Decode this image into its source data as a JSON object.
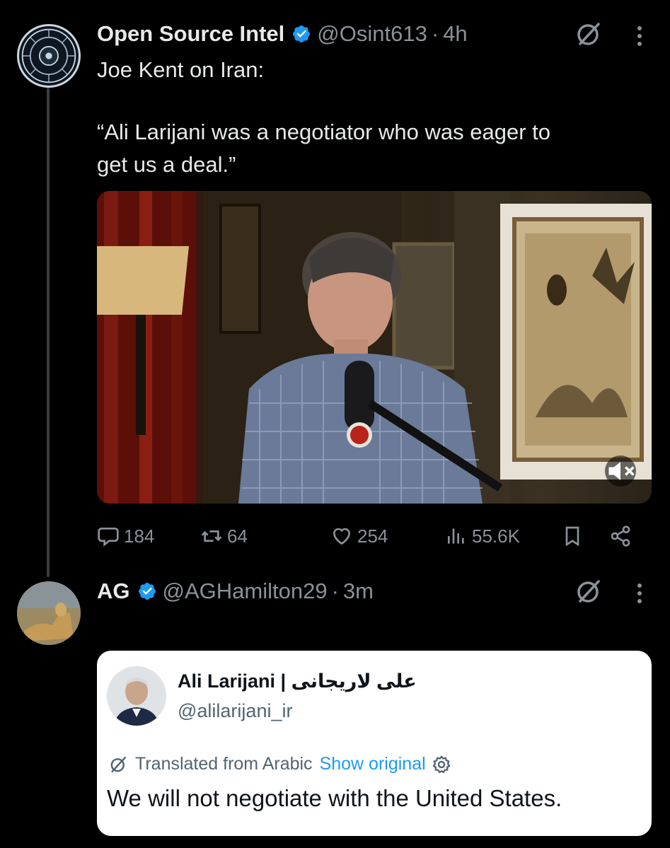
{
  "colors": {
    "background": "#000000",
    "text_primary": "#e7e9ea",
    "text_secondary": "#8b9198",
    "verified": "#1d9bf0",
    "link": "#1d9bf0"
  },
  "tweet": {
    "author_name": "Open Source Intel",
    "handle": "@Osint613",
    "separator": "·",
    "time": "4h",
    "text_line1": "Joe Kent on Iran:",
    "text_line2": "“Ali Larijani was a negotiator who was eager to",
    "text_line3": "get us a deal.”",
    "media": {
      "type": "video",
      "watermark_icon": "tucker-carlson-logo",
      "mute_icon": "speaker-muted-icon"
    },
    "actions": {
      "replies": "184",
      "reposts": "64",
      "likes": "254",
      "views": "55.6K"
    }
  },
  "reply": {
    "author_name": "AG",
    "handle": "@AGHamilton29",
    "separator": "·",
    "time": "3m",
    "quote": {
      "author_name": "Ali Larijani | علی لاریجانی",
      "handle": "@alilarijani_ir",
      "translated_label": "Translated from Arabic",
      "show_original_label": "Show original",
      "body": "We will not negotiate with the United States."
    }
  }
}
